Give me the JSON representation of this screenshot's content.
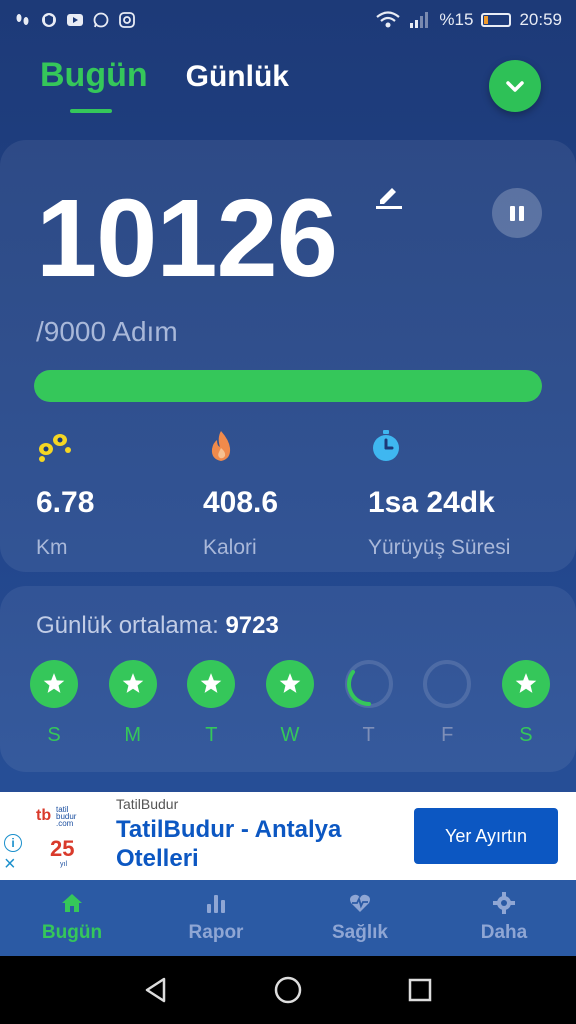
{
  "status_bar": {
    "battery_percent": "%15",
    "battery_level": 0.15,
    "time": "20:59",
    "left_icons": [
      "footprints-icon",
      "shield-icon",
      "youtube-icon",
      "whatsapp-icon",
      "instagram-icon"
    ],
    "right_icons": [
      "wifi-icon",
      "signal-icon",
      "battery-icon"
    ]
  },
  "header": {
    "tabs": [
      {
        "label": "Bugün",
        "active": true
      },
      {
        "label": "Günlük",
        "active": false
      }
    ],
    "dropdown_icon": "chevron-down-icon"
  },
  "today": {
    "steps": "10126",
    "goal": "/9000 Adım",
    "progress": 1.0,
    "stats": [
      {
        "value": "6.78",
        "label": "Km",
        "icon": "footprints-icon",
        "color": "#f5d623"
      },
      {
        "value": "408.6",
        "label": "Kalori",
        "icon": "flame-icon",
        "color": "#f08a4b"
      },
      {
        "value": "1sa 24dk",
        "label": "Yürüyüş Süresi",
        "icon": "stopwatch-icon",
        "color": "#3fb7f0"
      }
    ]
  },
  "weekly": {
    "avg_label": "Günlük ortalama:",
    "avg_value": "9723",
    "days": [
      {
        "letter": "S",
        "state": "done"
      },
      {
        "letter": "M",
        "state": "done"
      },
      {
        "letter": "T",
        "state": "done"
      },
      {
        "letter": "W",
        "state": "done"
      },
      {
        "letter": "T",
        "state": "partial"
      },
      {
        "letter": "F",
        "state": "empty"
      },
      {
        "letter": "S",
        "state": "done"
      }
    ]
  },
  "ad": {
    "source": "TatilBudur",
    "title": "TatilBudur - Antalya Otelleri",
    "button": "Yer Ayırtın",
    "logo_text": [
      "tatil",
      "budur",
      ".com",
      "25",
      "yıl"
    ]
  },
  "bottom_nav": [
    {
      "label": "Bugün",
      "icon": "home-icon",
      "active": true
    },
    {
      "label": "Rapor",
      "icon": "bar-chart-icon",
      "active": false
    },
    {
      "label": "Sağlık",
      "icon": "heart-pulse-icon",
      "active": false
    },
    {
      "label": "Daha",
      "icon": "gear-icon",
      "active": false
    }
  ],
  "colors": {
    "accent": "#35c75a",
    "background": "#1d3a78",
    "ad_blue": "#0c57c2"
  }
}
